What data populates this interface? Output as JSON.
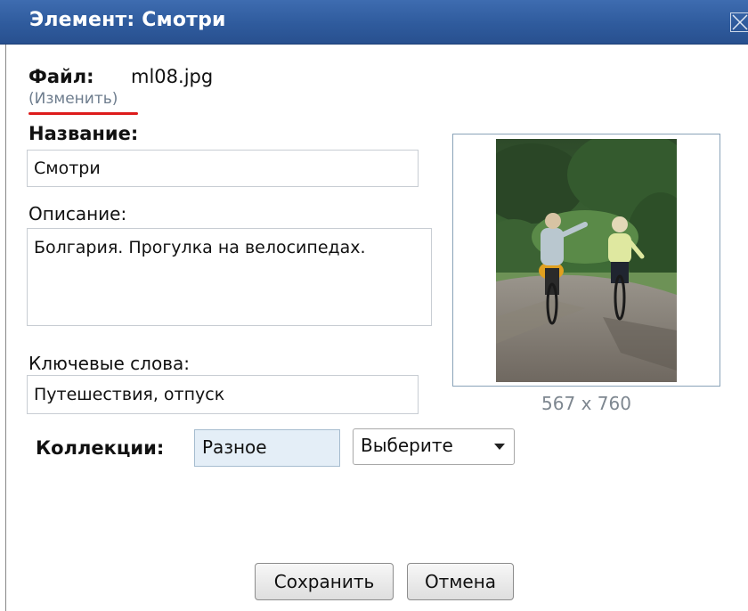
{
  "dialog": {
    "title": "Элемент: Смотри"
  },
  "file": {
    "label": "Файл:",
    "name": "ml08.jpg",
    "change_link": "(Изменить)"
  },
  "fields": {
    "name_label": "Название:",
    "name_value": "Смотри",
    "description_label": "Описание:",
    "description_value": "Болгария. Прогулка на велосипедах.",
    "keywords_label": "Ключевые слова:",
    "keywords_value": "Путешествия, отпуск"
  },
  "image": {
    "dimensions_text": "567 x 760"
  },
  "collections": {
    "label": "Коллекции:",
    "selected": "Разное",
    "dropdown_value": "Выберите"
  },
  "buttons": {
    "save": "Сохранить",
    "cancel": "Отмена"
  },
  "colors": {
    "titlebar": "#2f5b9d",
    "link": "#6e7d8e",
    "underline": "#dd1b1b",
    "chip_background": "#e4eef7"
  },
  "icons": {
    "close": "close-x-icon",
    "dropdown": "caret-down-icon"
  }
}
